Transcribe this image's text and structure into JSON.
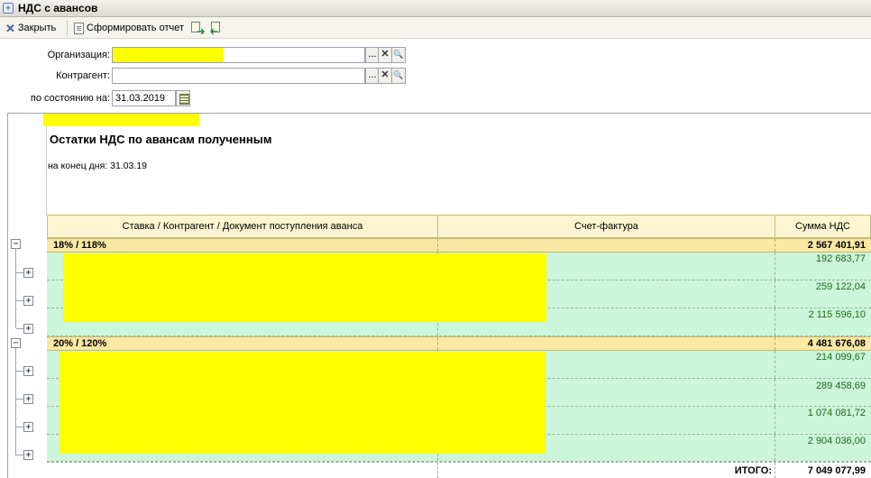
{
  "window": {
    "title": "НДС с авансов"
  },
  "toolbar": {
    "close_label": "Закрыть",
    "report_label": "Сформировать отчет"
  },
  "form": {
    "org_label": "Организация:",
    "org_value": "",
    "contractor_label": "Контрагент:",
    "contractor_value": "",
    "date_label": "по состоянию на:",
    "date_value": "31.03.2019",
    "select_glyph": "...",
    "clear_glyph": "✕",
    "search_glyph": "🔍"
  },
  "report": {
    "title": "Остатки НДС по авансам полученным",
    "subtitle": "на конец дня: 31.03.19",
    "columns": [
      "Ставка / Контрагент / Документ поступления аванса",
      "Счет-фактура",
      "Сумма НДС"
    ],
    "groups": [
      {
        "label": "18% / 118%",
        "total": "2 567 401,91",
        "rows": [
          "192 683,77",
          "259 122,04",
          "2 115 596,10"
        ]
      },
      {
        "label": "20% / 120%",
        "total": "4 481 676,08",
        "rows": [
          "214 099,67",
          "289 458,69",
          "1 074 081,72",
          "2 904 036,00"
        ]
      }
    ],
    "total_label": "ИТОГО:",
    "total_value": "7 049 077,99"
  },
  "colors": {
    "highlight": "#ffff00",
    "group_row": "#fae8a4",
    "data_row": "#ccf5d9",
    "amount_text": "#1b6b1b"
  }
}
